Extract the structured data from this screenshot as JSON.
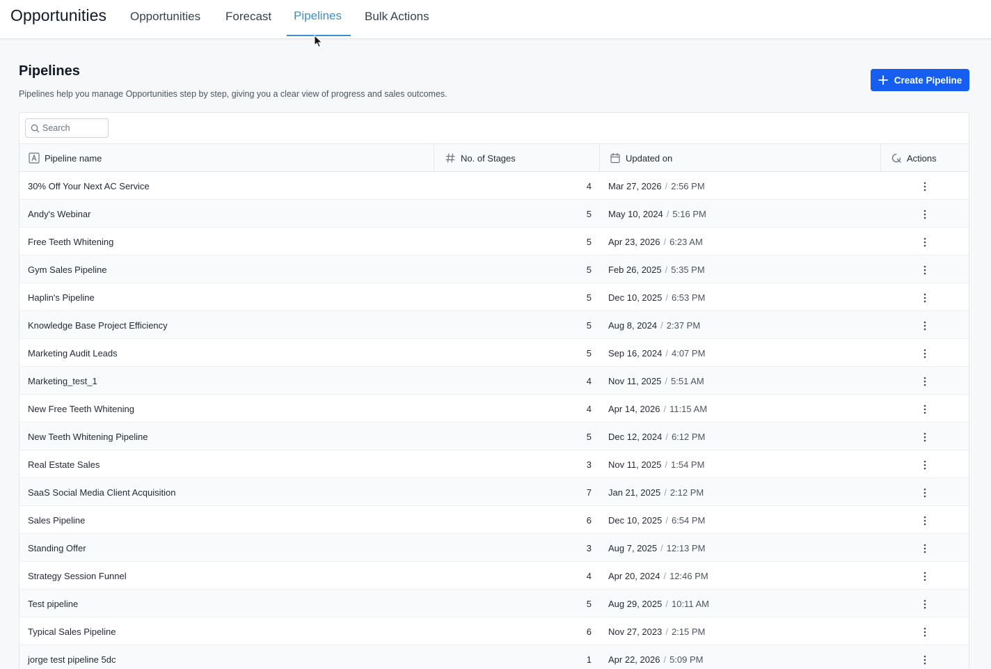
{
  "header": {
    "app_title": "Opportunities",
    "tabs": [
      {
        "label": "Opportunities",
        "active": false
      },
      {
        "label": "Forecast",
        "active": false
      },
      {
        "label": "Pipelines",
        "active": true
      },
      {
        "label": "Bulk Actions",
        "active": false
      }
    ]
  },
  "page": {
    "title": "Pipelines",
    "description": "Pipelines help you manage Opportunities step by step, giving you a clear view of progress and sales outcomes.",
    "create_button": "Create Pipeline",
    "search_placeholder": "Search"
  },
  "colors": {
    "accent": "#155eef",
    "active_tab": "#3b8fd0"
  },
  "icons": {
    "name_column": "text-icon",
    "stages_column": "hash-icon",
    "updated_column": "calendar-icon",
    "actions_column": "actions-icon",
    "row_action": "kebab-menu-icon",
    "search": "search-icon",
    "create": "plus-icon"
  },
  "table": {
    "columns": [
      "Pipeline name",
      "No. of Stages",
      "Updated on",
      "Actions"
    ],
    "rows": [
      {
        "name": "30% Off Your Next AC Service",
        "stages": "4",
        "date": "Mar 27, 2026",
        "time": "2:56 PM"
      },
      {
        "name": "Andy's Webinar",
        "stages": "5",
        "date": "May 10, 2024",
        "time": "5:16 PM"
      },
      {
        "name": "Free Teeth Whitening",
        "stages": "5",
        "date": "Apr 23, 2026",
        "time": "6:23 AM"
      },
      {
        "name": "Gym Sales Pipeline",
        "stages": "5",
        "date": "Feb 26, 2025",
        "time": "5:35 PM"
      },
      {
        "name": "Haplin's Pipeline",
        "stages": "5",
        "date": "Dec 10, 2025",
        "time": "6:53 PM"
      },
      {
        "name": "Knowledge Base Project Efficiency",
        "stages": "5",
        "date": "Aug 8, 2024",
        "time": "2:37 PM"
      },
      {
        "name": "Marketing Audit Leads",
        "stages": "5",
        "date": "Sep 16, 2024",
        "time": "4:07 PM"
      },
      {
        "name": "Marketing_test_1",
        "stages": "4",
        "date": "Nov 11, 2025",
        "time": "5:51 AM"
      },
      {
        "name": "New Free Teeth Whitening",
        "stages": "4",
        "date": "Apr 14, 2026",
        "time": "11:15 AM"
      },
      {
        "name": "New Teeth Whitening Pipeline",
        "stages": "5",
        "date": "Dec 12, 2024",
        "time": "6:12 PM"
      },
      {
        "name": "Real Estate Sales",
        "stages": "3",
        "date": "Nov 11, 2025",
        "time": "1:54 PM"
      },
      {
        "name": "SaaS Social Media Client Acquisition",
        "stages": "7",
        "date": "Jan 21, 2025",
        "time": "2:12 PM"
      },
      {
        "name": "Sales Pipeline",
        "stages": "6",
        "date": "Dec 10, 2025",
        "time": "6:54 PM"
      },
      {
        "name": "Standing Offer",
        "stages": "3",
        "date": "Aug 7, 2025",
        "time": "12:13 PM"
      },
      {
        "name": "Strategy Session Funnel",
        "stages": "4",
        "date": "Apr 20, 2024",
        "time": "12:46 PM"
      },
      {
        "name": "Test pipeline",
        "stages": "5",
        "date": "Aug 29, 2025",
        "time": "10:11 AM"
      },
      {
        "name": "Typical Sales Pipeline",
        "stages": "6",
        "date": "Nov 27, 2023",
        "time": "2:15 PM"
      },
      {
        "name": "jorge test pipeline 5dc",
        "stages": "1",
        "date": "Apr 22, 2026",
        "time": "5:09 PM"
      }
    ]
  }
}
